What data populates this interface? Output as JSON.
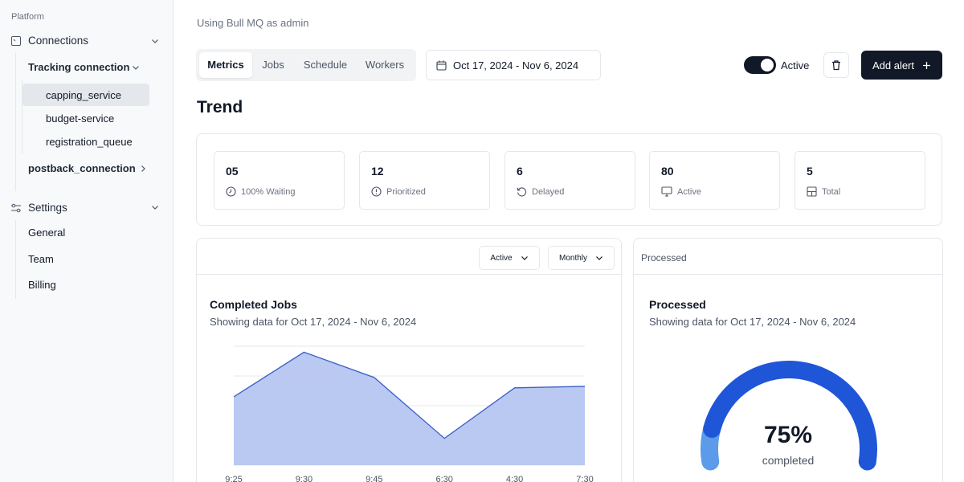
{
  "sidebar": {
    "heading": "Platform",
    "connections_label": "Connections",
    "tracking_label": "Tracking connection",
    "items": [
      "capping_service",
      "budget-service",
      "registration_queue"
    ],
    "postback_label": "postback_connection",
    "settings_label": "Settings",
    "settings_items": [
      "General",
      "Team",
      "Billing"
    ]
  },
  "header": {
    "subtitle": "Using Bull MQ as admin",
    "tabs": [
      "Metrics",
      "Jobs",
      "Schedule",
      "Workers"
    ],
    "active_tab": "Metrics",
    "date_range": "Oct 17, 2024 - Nov 6, 2024",
    "toggle_label": "Active",
    "toggle_on": true,
    "add_alert_label": "Add alert"
  },
  "trend": {
    "title": "Trend",
    "stats": [
      {
        "value": "05",
        "label": "100% Waiting",
        "icon": "clock-icon"
      },
      {
        "value": "12",
        "label": "Prioritized",
        "icon": "alert-circle-icon"
      },
      {
        "value": "6",
        "label": "Delayed",
        "icon": "rotate-ccw-icon"
      },
      {
        "value": "80",
        "label": "Active",
        "icon": "monitor-icon"
      },
      {
        "value": "5",
        "label": "Total",
        "icon": "layout-grid-icon"
      }
    ]
  },
  "jobs_card": {
    "filter_status": "Active",
    "filter_period": "Monthly",
    "title": "Completed Jobs",
    "subtitle": "Showing data for Oct 17, 2024 - Nov 6, 2024"
  },
  "processed_card": {
    "header": "Processed",
    "title": "Processed",
    "subtitle": "Showing data for Oct 17, 2024 - Nov 6, 2024",
    "percent_label": "75%",
    "caption": "completed",
    "percent_value": 0.75
  },
  "colors": {
    "accent": "#1f56d8",
    "area_fill": "#b6c6f1",
    "area_line": "#3b5fc5",
    "dark": "#111827",
    "gauge_light": "#5b9bea"
  },
  "chart_data": {
    "type": "area",
    "categories": [
      "9:25",
      "9:30",
      "9:45",
      "6:30",
      "4:30",
      "7:30"
    ],
    "values": [
      46,
      76,
      59,
      18,
      52,
      53
    ],
    "ylim": [
      0,
      80
    ],
    "grid": true,
    "title": "Completed Jobs"
  }
}
